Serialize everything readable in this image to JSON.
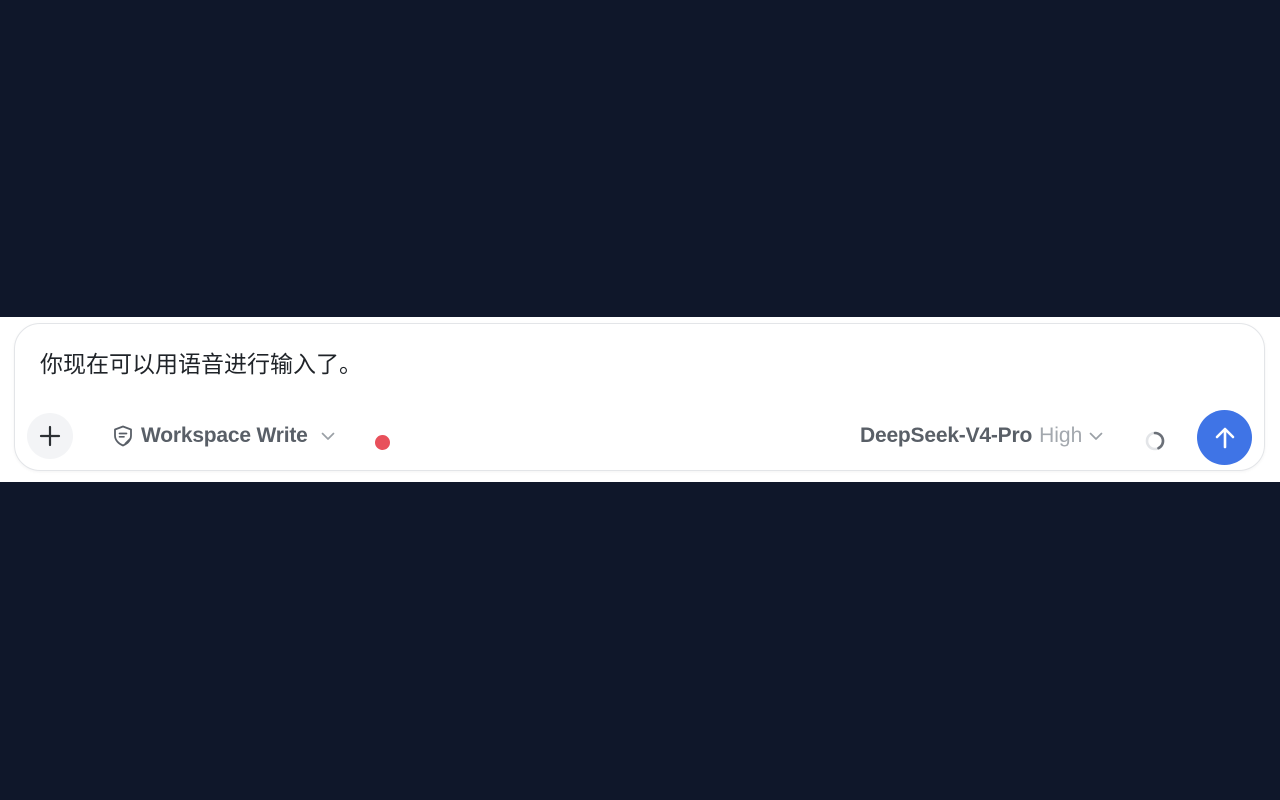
{
  "composer": {
    "prompt_text": "你现在可以用语音进行输入了。",
    "mode": {
      "label": "Workspace Write",
      "icon": "shield-edit-icon"
    },
    "recording_indicator": {
      "color": "#e8505b"
    },
    "model": {
      "name": "DeepSeek-V4-Pro",
      "effort": "High"
    },
    "actions": {
      "add_icon": "plus-icon",
      "send_icon": "arrow-up-icon",
      "loading_icon": "spinner-icon"
    }
  },
  "colors": {
    "background": "#0f172a",
    "surface": "#ffffff",
    "accent": "#3f74e6",
    "muted_text": "#a3a8ae",
    "label_text": "#595f67"
  }
}
